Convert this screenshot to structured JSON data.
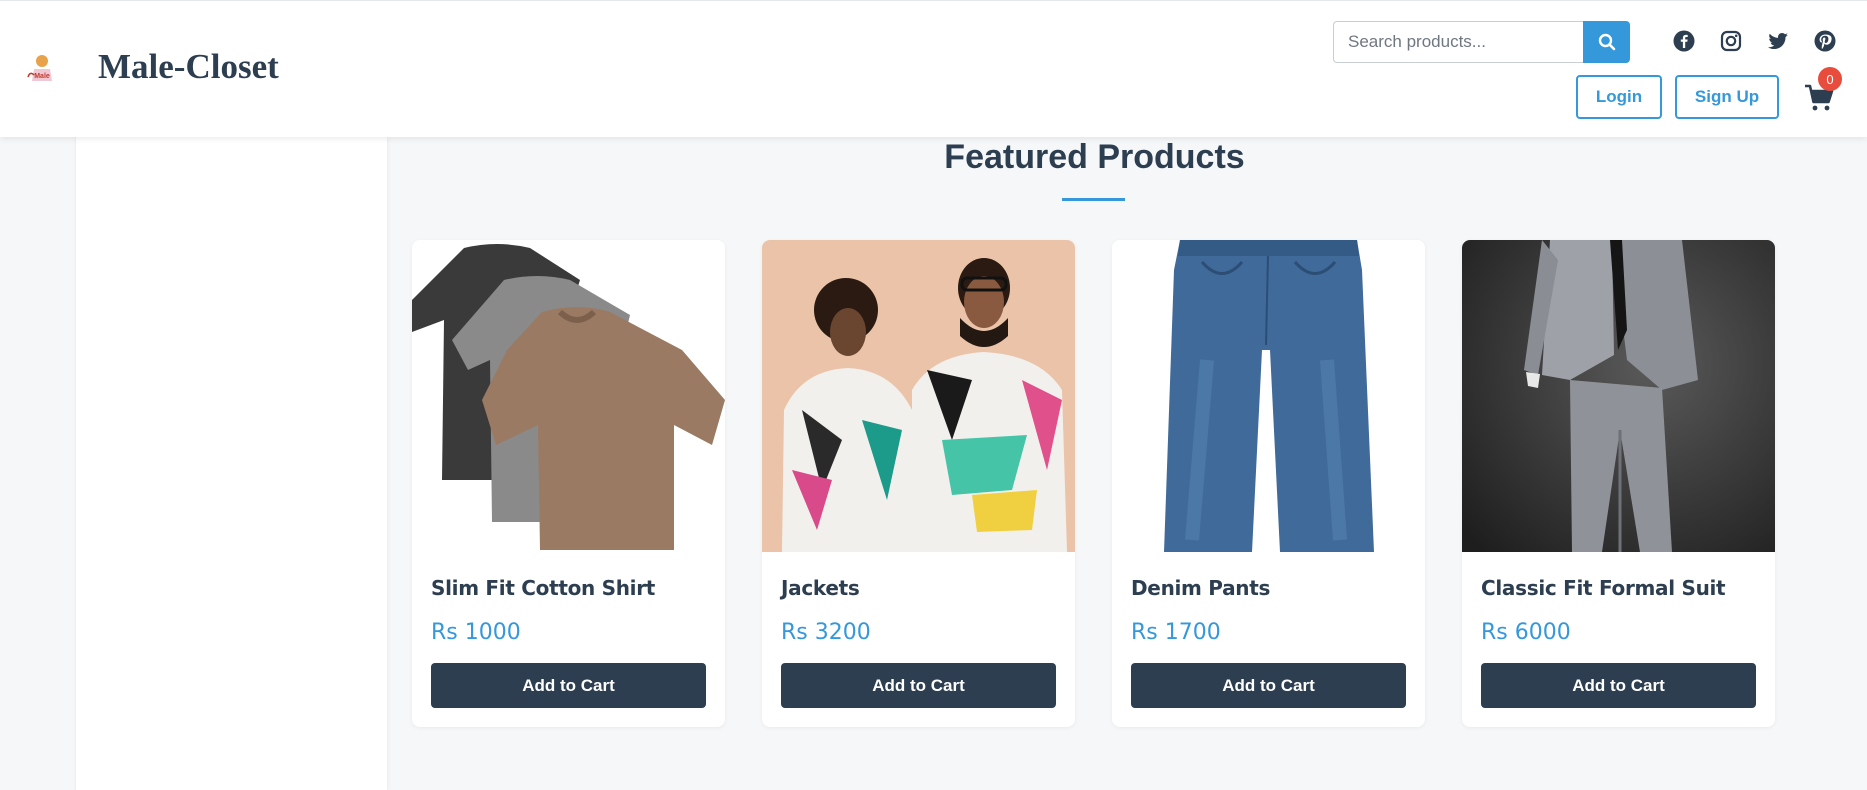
{
  "header": {
    "brand": "Male-Closet",
    "logo_text": "Male",
    "search": {
      "placeholder": "Search products...",
      "icon": "search-icon"
    },
    "socials": [
      "facebook-icon",
      "instagram-icon",
      "twitter-icon",
      "pinterest-icon"
    ],
    "login_label": "Login",
    "signup_label": "Sign Up",
    "cart_count": "0"
  },
  "main": {
    "section_title": "Featured Products",
    "products": [
      {
        "name": "Slim Fit Cotton Shirt",
        "price": "Rs 1000",
        "button": "Add to Cart",
        "image": "t-shirts-image"
      },
      {
        "name": "Jackets",
        "price": "Rs 3200",
        "button": "Add to Cart",
        "image": "jackets-image"
      },
      {
        "name": "Denim Pants",
        "price": "Rs 1700",
        "button": "Add to Cart",
        "image": "denim-pants-image"
      },
      {
        "name": "Classic Fit Formal Suit",
        "price": "Rs 6000",
        "button": "Add to Cart",
        "image": "formal-suit-image"
      }
    ]
  },
  "colors": {
    "accent": "#3498db",
    "dark": "#2c3e50",
    "badge": "#e74c3c",
    "background": "#f5f7f9"
  }
}
